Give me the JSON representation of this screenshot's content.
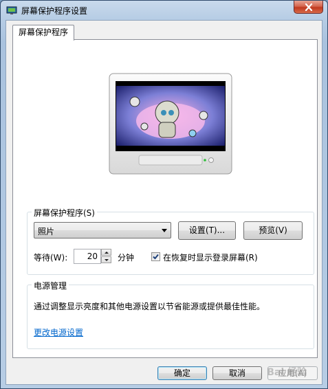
{
  "window": {
    "title": "屏幕保护程序设置",
    "icon": "screensaver-app-icon",
    "close_icon": "close-icon"
  },
  "tab": {
    "label": "屏幕保护程序"
  },
  "screensaver_group": {
    "label": "屏幕保护程序(S)",
    "selected": "照片",
    "settings_button": "设置(T)...",
    "preview_button": "预览(V)",
    "wait_label": "等待(W):",
    "wait_value": "20",
    "minutes_label": "分钟",
    "resume_checkbox_label": "在恢复时显示登录屏幕(R)",
    "resume_checked": true
  },
  "power_group": {
    "label": "电源管理",
    "description": "通过调整显示亮度和其他电源设置以节省能源或提供最佳性能。",
    "link": "更改电源设置"
  },
  "footer": {
    "ok": "确定",
    "cancel": "取消",
    "apply": "应用(A)"
  },
  "watermark": "Bai 经验",
  "colors": {
    "link": "#0066cc",
    "close_button": "#c1391f",
    "window_frame": "#b7cde5"
  }
}
